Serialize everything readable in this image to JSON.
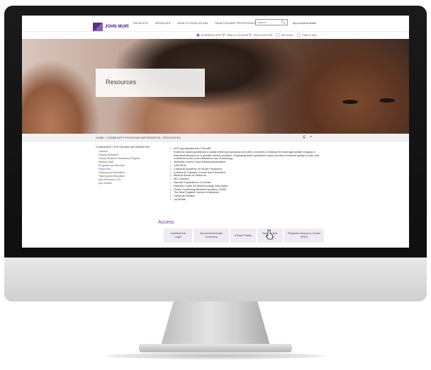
{
  "header": {
    "logo_name": "JOHN MUIR",
    "logo_sub": "HEALTH",
    "nav": [
      "PATIENTS",
      "SERVICES",
      "HEALTH EDUCATION",
      "HEALTHCARE PROFESSIONALS"
    ],
    "search_placeholder": "Search",
    "mychart": "MyJohnMuirHealth"
  },
  "utility": [
    {
      "icon": "calendar-icon",
      "label": "SCHEDULE APPT"
    },
    {
      "icon": "doctor-icon",
      "label": "FIND A LOCATION"
    },
    {
      "icon": "doctor-icon",
      "label": "FIND A DOCTOR"
    },
    {
      "icon": "pay-icon",
      "label": "PAY A BILL"
    },
    {
      "icon": "gift-icon",
      "label": "FIND A JOB"
    }
  ],
  "hero": {
    "title": "Resources"
  },
  "breadcrumb": "HOME / COMMUNITY PHYSICIAN INFORMATION / RESOURCES",
  "sidebar": {
    "title": "COMMUNITY PHYSICIAN INFORMATION",
    "items": [
      {
        "label": "Careers"
      },
      {
        "label": "Clinical Research"
      },
      {
        "label": "Family Medicine Residency Program"
      },
      {
        "label": "Medical Staff"
      },
      {
        "label": "Programs and Services"
      },
      {
        "label": "Resources",
        "active": true
      },
      {
        "label": "Training and Education"
      },
      {
        "label": "Training and Education"
      },
      {
        "label": "Epic Resource CCC"
      },
      {
        "label": "Epic Mobile"
      }
    ]
  },
  "content": {
    "first_bullet": "ACR Appropriateness Criteria®",
    "first_desc": "Evidence-based guidelines to assist referring physicians and other providers in making the most appropriate imaging or treatment decision for a specific clinical condition. Employing these guidelines helps providers enhance quality of care and contribute to the most efficacious use of radiology.",
    "bullets": [
      "Alameda-Contra Costa Medical Association",
      "Cal/OSHA",
      "California Academy of Family Physicians",
      "Centers for Disease Control and Prevention",
      "Medical Board of California",
      "MD Calculus",
      "Narcotic Equivalence Converter",
      "National Center for Biotechnology Information",
      "Online Continuing Medical Education (CME)",
      "The New England Journal of Medicine",
      "Unbound Medline",
      "UpToDate"
    ],
    "access_heading": "Access",
    "access_buttons": [
      "JohnMuirLink Login",
      "MyJohnMuirHealth eLearning",
      "eTeam Portals",
      "Remote Epic Access",
      "Physician Resource Center (PRC)"
    ]
  },
  "colors": {
    "accent": "#6b3f95",
    "bezel": "#111111"
  }
}
